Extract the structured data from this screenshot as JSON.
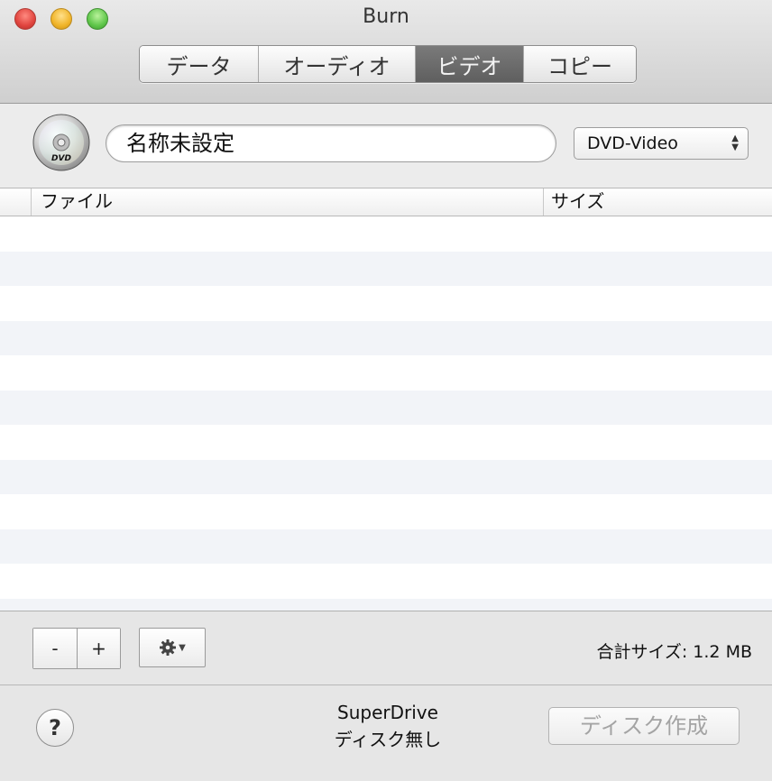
{
  "window": {
    "title": "Burn"
  },
  "tabs": [
    {
      "label": "データ",
      "active": false
    },
    {
      "label": "オーディオ",
      "active": false
    },
    {
      "label": "ビデオ",
      "active": true
    },
    {
      "label": "コピー",
      "active": false
    }
  ],
  "disc_icon": {
    "icon": "dvd-disc-icon",
    "label": "DVD"
  },
  "disc_name": {
    "value": "名称未設定"
  },
  "disc_type": {
    "selected": "DVD-Video"
  },
  "table": {
    "columns": [
      "ファイル",
      "サイズ"
    ],
    "rows": []
  },
  "controls": {
    "remove_label": "-",
    "add_label": "+",
    "action_icon": "gear-icon",
    "total_size": "合計サイズ: 1.2 MB"
  },
  "status": {
    "help_label": "?",
    "drive_name": "SuperDrive",
    "drive_status": "ディスク無し",
    "burn_label": "ディスク作成"
  }
}
